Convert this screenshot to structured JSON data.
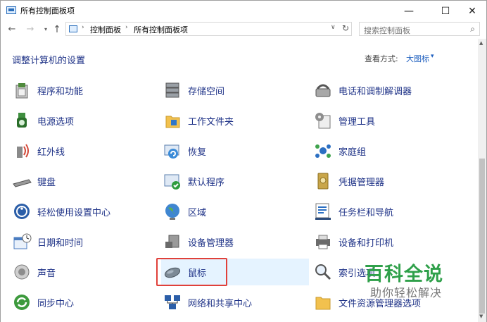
{
  "window": {
    "title": "所有控制面板项",
    "buttons": {
      "minimize": "—",
      "maximize": "☐",
      "close": "✕"
    }
  },
  "nav": {
    "back": "←",
    "forward": "→",
    "recent": "▾",
    "up": "↑",
    "breadcrumbs": [
      "控制面板",
      "所有控制面板项"
    ],
    "separator": "›",
    "dropdown": "∨",
    "refresh": "↻",
    "search_placeholder": "搜索控制面板",
    "search_icon": "⌕"
  },
  "content": {
    "heading": "调整计算机的设置",
    "view_by_label": "查看方式:",
    "view_by_value": "大图标",
    "view_by_arrow": "▾"
  },
  "items": {
    "col1": [
      "程序和功能",
      "电源选项",
      "红外线",
      "键盘",
      "轻松使用设置中心",
      "日期和时间",
      "声音",
      "同步中心"
    ],
    "col2": [
      "存储空间",
      "工作文件夹",
      "恢复",
      "默认程序",
      "区域",
      "设备管理器",
      "鼠标",
      "网络和共享中心"
    ],
    "col3": [
      "电话和调制解调器",
      "管理工具",
      "家庭组",
      "凭据管理器",
      "任务栏和导航",
      "设备和打印机",
      "索引选项",
      "文件资源管理器选项"
    ]
  },
  "selected_item": "鼠标",
  "watermark": {
    "main": "百科全说",
    "sub": "助你轻松解决"
  },
  "colors": {
    "link": "#1e3287",
    "accent": "#1e5fbf",
    "highlight": "#e0403a",
    "watermark": "#2fa04a",
    "hover": "#e5f3ff"
  }
}
